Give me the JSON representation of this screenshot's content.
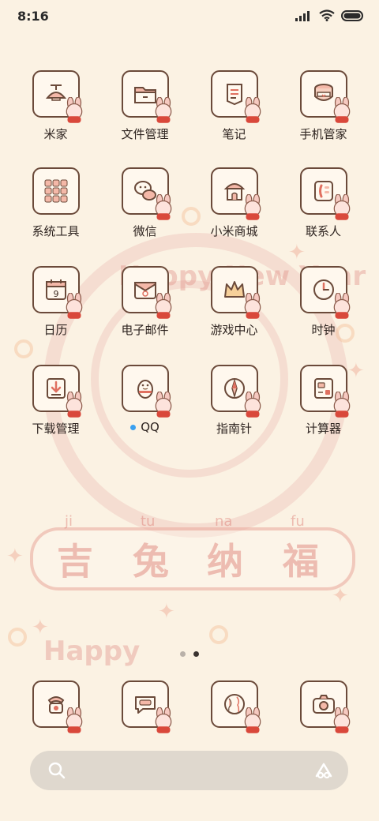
{
  "status_bar": {
    "time": "8:16",
    "battery_icon": "battery-icon",
    "wifi_icon": "wifi-icon",
    "signal_icon": "signal-icon"
  },
  "apps": [
    {
      "label": "米家",
      "icon": "lamp-icon"
    },
    {
      "label": "文件管理",
      "icon": "folder-icon"
    },
    {
      "label": "笔记",
      "icon": "note-icon"
    },
    {
      "label": "手机管家",
      "icon": "shield-pot-icon"
    },
    {
      "label": "系统工具",
      "icon": "tools-folder-icon"
    },
    {
      "label": "微信",
      "icon": "chat-bubbles-icon"
    },
    {
      "label": "小米商城",
      "icon": "store-tent-icon"
    },
    {
      "label": "联系人",
      "icon": "contacts-icon"
    },
    {
      "label": "日历",
      "icon": "calendar-icon",
      "calendar_day": "9"
    },
    {
      "label": "电子邮件",
      "icon": "envelope-icon"
    },
    {
      "label": "游戏中心",
      "icon": "crown-icon"
    },
    {
      "label": "时钟",
      "icon": "clock-icon"
    },
    {
      "label": "下载管理",
      "icon": "download-icon"
    },
    {
      "label": "QQ",
      "icon": "penguin-icon",
      "has_dot": true
    },
    {
      "label": "指南针",
      "icon": "compass-icon"
    },
    {
      "label": "计算器",
      "icon": "calculator-icon"
    }
  ],
  "dock": [
    {
      "icon": "phone-icon"
    },
    {
      "icon": "message-icon"
    },
    {
      "icon": "browser-globe-icon"
    },
    {
      "icon": "camera-icon"
    }
  ],
  "pages": {
    "count": 2,
    "active": 2
  },
  "search": {
    "search_icon": "search-icon",
    "assistant_icon": "assistant-icon"
  },
  "wallpaper": {
    "characters": [
      "吉",
      "兔",
      "纳",
      "福"
    ],
    "pinyin": [
      "ji",
      "tu",
      "na",
      "fu"
    ],
    "ring_text": "Happy New Year",
    "bottom_text": "Happy"
  },
  "colors": {
    "background": "#fbf2e3",
    "icon_border": "#6b4a3a",
    "accent_red": "#e07060",
    "dot_blue": "#3aa0f0"
  }
}
